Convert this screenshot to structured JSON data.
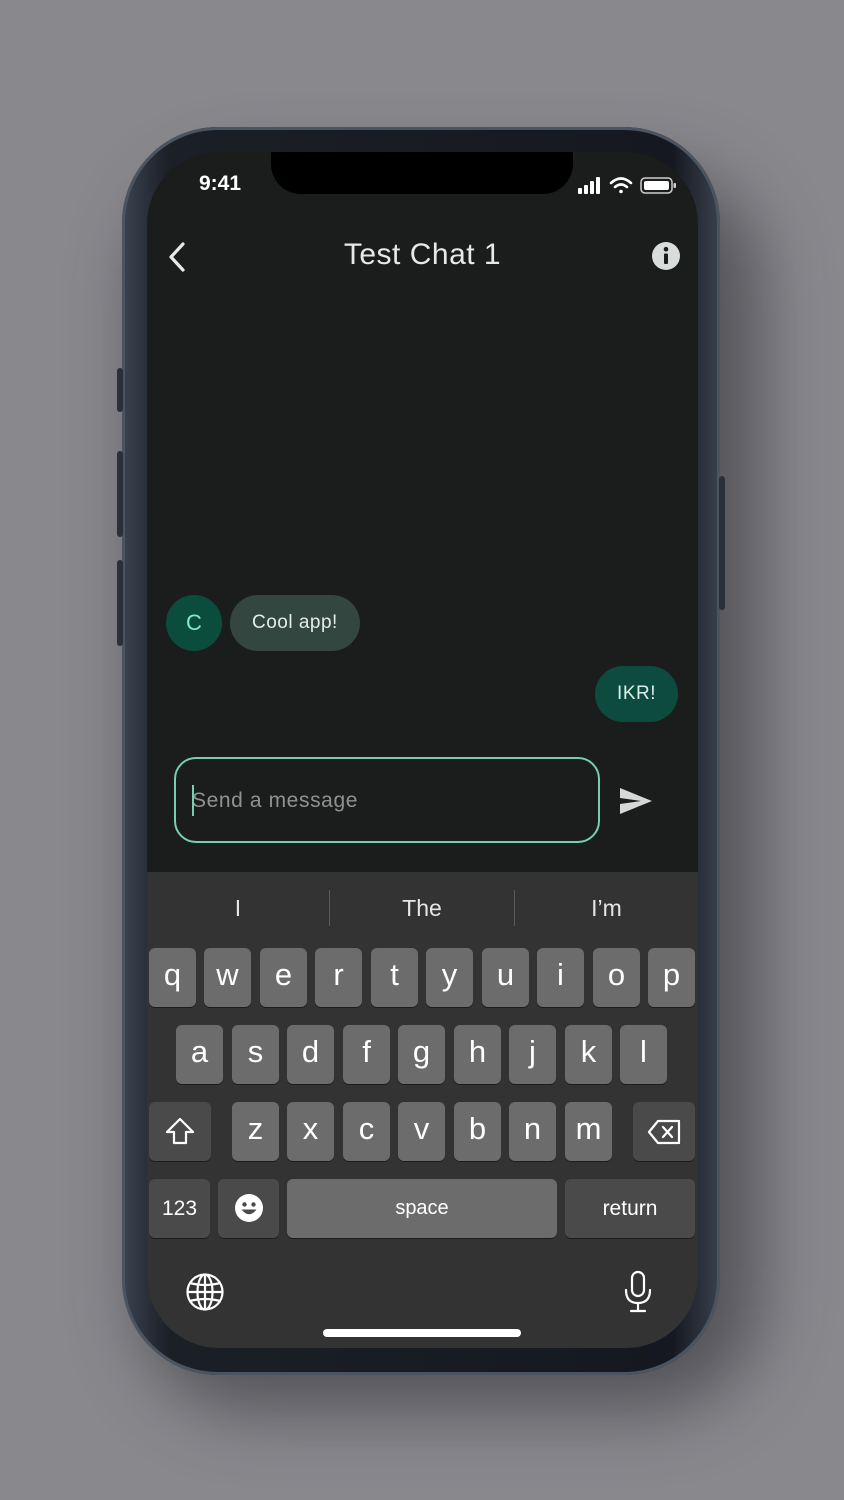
{
  "status_bar": {
    "time": "9:41"
  },
  "header": {
    "title": "Test Chat 1"
  },
  "icons": {
    "back": "chevron-left-icon",
    "info": "info-icon",
    "send": "send-icon",
    "shift": "shift-icon",
    "delete": "backspace-icon",
    "emoji": "emoji-icon",
    "globe": "globe-icon",
    "mic": "microphone-icon"
  },
  "messages": [
    {
      "sender_initial": "C",
      "text": "Cool app!",
      "direction": "incoming"
    },
    {
      "text": "IKR!",
      "direction": "outgoing"
    }
  ],
  "composer": {
    "placeholder": "Send a message",
    "value": ""
  },
  "keyboard": {
    "suggestions": [
      "I",
      "The",
      "I’m"
    ],
    "row1": [
      "q",
      "w",
      "e",
      "r",
      "t",
      "y",
      "u",
      "i",
      "o",
      "p"
    ],
    "row2": [
      "a",
      "s",
      "d",
      "f",
      "g",
      "h",
      "j",
      "k",
      "l"
    ],
    "row3": [
      "z",
      "x",
      "c",
      "v",
      "b",
      "n",
      "m"
    ],
    "numbers_label": "123",
    "space_label": "space",
    "return_label": "return"
  },
  "colors": {
    "accent": "#74d1ad",
    "avatar_bg": "#0b4d3c",
    "incoming_bubble": "#334640",
    "outgoing_bubble": "#0c4b3d",
    "screen_bg": "#1b1d1c",
    "keyboard_bg": "#333333"
  }
}
